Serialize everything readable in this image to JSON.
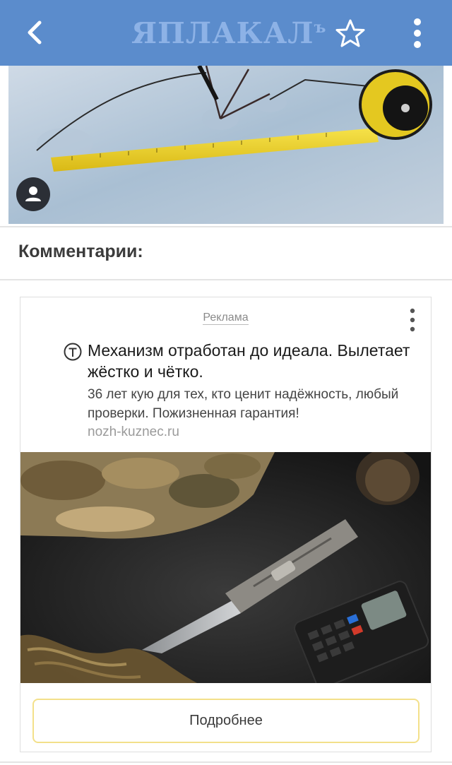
{
  "header": {
    "logo_text": "ЯПЛАКАЛ",
    "logo_suffix": "ъ",
    "brand_color": "#5b8ccc",
    "back_icon": "arrow-left-icon",
    "star_icon": "star-icon",
    "menu_icon": "more-vertical-icon"
  },
  "comments": {
    "title": "Комментарии:"
  },
  "ad": {
    "label": "Реклама",
    "title": "Механизм отработан до идеала. Вылетает жёстко и чётко.",
    "text": "36 лет кую для тех, кто ценит надёжность, любый проверки. Пожизненная гарантия!",
    "domain": "nozh-kuznec.ru",
    "button_label": "Подробнее",
    "button_border_color": "#f3e08a"
  }
}
